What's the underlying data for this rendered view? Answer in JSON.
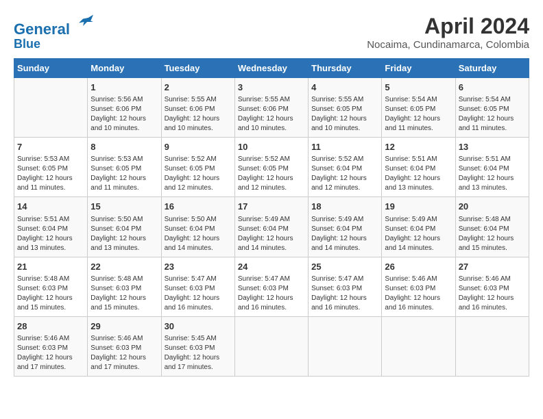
{
  "header": {
    "logo_line1": "General",
    "logo_line2": "Blue",
    "month": "April 2024",
    "location": "Nocaima, Cundinamarca, Colombia"
  },
  "days_of_week": [
    "Sunday",
    "Monday",
    "Tuesday",
    "Wednesday",
    "Thursday",
    "Friday",
    "Saturday"
  ],
  "weeks": [
    [
      {
        "day": "",
        "info": ""
      },
      {
        "day": "1",
        "info": "Sunrise: 5:56 AM\nSunset: 6:06 PM\nDaylight: 12 hours\nand 10 minutes."
      },
      {
        "day": "2",
        "info": "Sunrise: 5:55 AM\nSunset: 6:06 PM\nDaylight: 12 hours\nand 10 minutes."
      },
      {
        "day": "3",
        "info": "Sunrise: 5:55 AM\nSunset: 6:06 PM\nDaylight: 12 hours\nand 10 minutes."
      },
      {
        "day": "4",
        "info": "Sunrise: 5:55 AM\nSunset: 6:05 PM\nDaylight: 12 hours\nand 10 minutes."
      },
      {
        "day": "5",
        "info": "Sunrise: 5:54 AM\nSunset: 6:05 PM\nDaylight: 12 hours\nand 11 minutes."
      },
      {
        "day": "6",
        "info": "Sunrise: 5:54 AM\nSunset: 6:05 PM\nDaylight: 12 hours\nand 11 minutes."
      }
    ],
    [
      {
        "day": "7",
        "info": "Sunrise: 5:53 AM\nSunset: 6:05 PM\nDaylight: 12 hours\nand 11 minutes."
      },
      {
        "day": "8",
        "info": "Sunrise: 5:53 AM\nSunset: 6:05 PM\nDaylight: 12 hours\nand 11 minutes."
      },
      {
        "day": "9",
        "info": "Sunrise: 5:52 AM\nSunset: 6:05 PM\nDaylight: 12 hours\nand 12 minutes."
      },
      {
        "day": "10",
        "info": "Sunrise: 5:52 AM\nSunset: 6:05 PM\nDaylight: 12 hours\nand 12 minutes."
      },
      {
        "day": "11",
        "info": "Sunrise: 5:52 AM\nSunset: 6:04 PM\nDaylight: 12 hours\nand 12 minutes."
      },
      {
        "day": "12",
        "info": "Sunrise: 5:51 AM\nSunset: 6:04 PM\nDaylight: 12 hours\nand 13 minutes."
      },
      {
        "day": "13",
        "info": "Sunrise: 5:51 AM\nSunset: 6:04 PM\nDaylight: 12 hours\nand 13 minutes."
      }
    ],
    [
      {
        "day": "14",
        "info": "Sunrise: 5:51 AM\nSunset: 6:04 PM\nDaylight: 12 hours\nand 13 minutes."
      },
      {
        "day": "15",
        "info": "Sunrise: 5:50 AM\nSunset: 6:04 PM\nDaylight: 12 hours\nand 13 minutes."
      },
      {
        "day": "16",
        "info": "Sunrise: 5:50 AM\nSunset: 6:04 PM\nDaylight: 12 hours\nand 14 minutes."
      },
      {
        "day": "17",
        "info": "Sunrise: 5:49 AM\nSunset: 6:04 PM\nDaylight: 12 hours\nand 14 minutes."
      },
      {
        "day": "18",
        "info": "Sunrise: 5:49 AM\nSunset: 6:04 PM\nDaylight: 12 hours\nand 14 minutes."
      },
      {
        "day": "19",
        "info": "Sunrise: 5:49 AM\nSunset: 6:04 PM\nDaylight: 12 hours\nand 14 minutes."
      },
      {
        "day": "20",
        "info": "Sunrise: 5:48 AM\nSunset: 6:04 PM\nDaylight: 12 hours\nand 15 minutes."
      }
    ],
    [
      {
        "day": "21",
        "info": "Sunrise: 5:48 AM\nSunset: 6:03 PM\nDaylight: 12 hours\nand 15 minutes."
      },
      {
        "day": "22",
        "info": "Sunrise: 5:48 AM\nSunset: 6:03 PM\nDaylight: 12 hours\nand 15 minutes."
      },
      {
        "day": "23",
        "info": "Sunrise: 5:47 AM\nSunset: 6:03 PM\nDaylight: 12 hours\nand 16 minutes."
      },
      {
        "day": "24",
        "info": "Sunrise: 5:47 AM\nSunset: 6:03 PM\nDaylight: 12 hours\nand 16 minutes."
      },
      {
        "day": "25",
        "info": "Sunrise: 5:47 AM\nSunset: 6:03 PM\nDaylight: 12 hours\nand 16 minutes."
      },
      {
        "day": "26",
        "info": "Sunrise: 5:46 AM\nSunset: 6:03 PM\nDaylight: 12 hours\nand 16 minutes."
      },
      {
        "day": "27",
        "info": "Sunrise: 5:46 AM\nSunset: 6:03 PM\nDaylight: 12 hours\nand 16 minutes."
      }
    ],
    [
      {
        "day": "28",
        "info": "Sunrise: 5:46 AM\nSunset: 6:03 PM\nDaylight: 12 hours\nand 17 minutes."
      },
      {
        "day": "29",
        "info": "Sunrise: 5:46 AM\nSunset: 6:03 PM\nDaylight: 12 hours\nand 17 minutes."
      },
      {
        "day": "30",
        "info": "Sunrise: 5:45 AM\nSunset: 6:03 PM\nDaylight: 12 hours\nand 17 minutes."
      },
      {
        "day": "",
        "info": ""
      },
      {
        "day": "",
        "info": ""
      },
      {
        "day": "",
        "info": ""
      },
      {
        "day": "",
        "info": ""
      }
    ]
  ]
}
